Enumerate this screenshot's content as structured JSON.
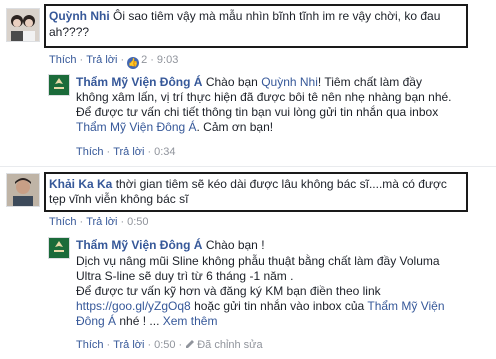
{
  "comment1": {
    "author": "Quỳnh Nhi",
    "text_line1": "Ôi sao tiêm vậy mà mẫu nhìn bĩnh tĩnh im re vậy chời, ko đau",
    "text_line2": "ah????",
    "like": "Thích",
    "reply": "Trả lời",
    "likes_count": "2",
    "time": "9:03"
  },
  "reply1": {
    "author": "Thẩm Mỹ Viện Đông Á",
    "lines": [
      "Chào bạn",
      "! Tiêm chất làm đầy",
      "không xâm lấn, vị trí thực hiện đã được bôi tê nên nhẹ nhàng bạn nhé.",
      "Để được tư vấn chi tiết thông tin bạn vui lòng gửi tin nhắn qua inbox",
      ". Cảm ơn bạn!"
    ],
    "mention1": "Quỳnh Nhi",
    "mention2": "Thẩm Mỹ Viện Đông Á",
    "like": "Thích",
    "reply": "Trả lời",
    "time": "0:34"
  },
  "comment2": {
    "author": "Khải Ka Ka",
    "text_line1": "thời gian tiêm sẽ kéo dài được lâu không bác sĩ....mà có được",
    "text_line2": "tẹp vĩnh viễn không bác sĩ",
    "like": "Thích",
    "reply": "Trả lời",
    "time": "0:50"
  },
  "reply2": {
    "author": "Thẩm Mỹ Viện Đông Á",
    "greeting": "Chào bạn !",
    "lines": [
      "Dịch vụ nâng mũi Sline không phẫu thuật bằng chất làm đầy Voluma",
      "Ultra S-line sẽ duy trì từ 6 tháng -1 năm .",
      "Để được tư vấn kỹ hơn và đăng ký KM bạn điền theo link",
      "hoặc gửi tin nhắn vào inbox của",
      "nhé ! ...",
      "Xem thêm"
    ],
    "link_url": "https://goo.gl/yZgOq8",
    "mention_part1": "Thẩm Mỹ Viện",
    "mention_part2": "Đông Á",
    "like": "Thích",
    "reply": "Trả lời",
    "time": "0:50",
    "edit": "Đã chỉnh sửa"
  },
  "colors": {
    "link": "#365899",
    "meta": "#90949c",
    "box": "#1a1a1a",
    "logo_green": "#1b6b3a"
  }
}
